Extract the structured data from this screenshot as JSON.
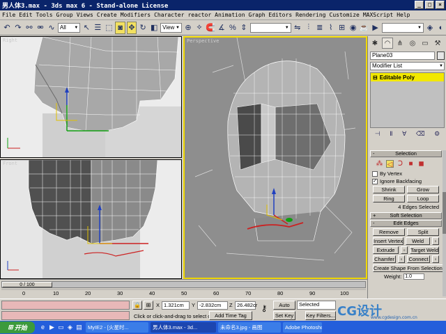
{
  "window": {
    "title": "男人体3.max - 3ds max 6 - Stand-alone License",
    "controls": [
      "_",
      "□",
      "×"
    ]
  },
  "menu": [
    "File",
    "Edit",
    "Tools",
    "Group",
    "Views",
    "Create",
    "Modifiers",
    "Character",
    "reactor",
    "Animation",
    "Graph Editors",
    "Rendering",
    "Customize",
    "MAXScript",
    "Help"
  ],
  "toolbar": {
    "selection_filter": "All",
    "ref_coord": "View",
    "named_sel": ""
  },
  "viewports": {
    "right": "Right",
    "front": "Front",
    "perspective": "Perspective"
  },
  "timeline": {
    "frame_display": "0 / 100",
    "ticks": [
      "0",
      "10",
      "20",
      "30",
      "40",
      "50",
      "60",
      "70",
      "80",
      "90",
      "100"
    ]
  },
  "status": {
    "prompt": "Click or click-and-drag to select obj",
    "add_time_tag": "Add Time Tag",
    "x_label": "X",
    "x_value": "1.321cm",
    "y_label": "Y",
    "y_value": "-2.832cm",
    "z_label": "Z",
    "z_value": "26.482cr",
    "auto_key": "Auto Key",
    "selected": "Selected",
    "set_key": "Set Key",
    "key_filters": "Key Filters..."
  },
  "panel": {
    "object_name": "Plane03",
    "object_color": "#e6e6e6",
    "modifier_list": "Modifier List",
    "stack_item": "Editable Poly",
    "selection": {
      "title": "Selection",
      "by_vertex": "By Vertex",
      "ignore_backfacing": "Ignore Backfacing",
      "shrink": "Shrink",
      "grow": "Grow",
      "ring": "Ring",
      "loop": "Loop",
      "info": "4 Edges Selected"
    },
    "soft_selection": "Soft Selection",
    "edit_edges": {
      "title": "Edit Edges",
      "remove": "Remove",
      "split": "Split",
      "insert_vertex": "Insert Vertex",
      "weld": "Weld",
      "extrude": "Extrude",
      "target_weld": "Target Weld",
      "chamfer": "Chamfer",
      "connect": "Connect",
      "create_shape": "Create Shape From Selection",
      "weight_label": "Weight:",
      "weight_value": "1.0"
    }
  },
  "taskbar": {
    "start": "开始",
    "tasks": [
      "MyIE2 - [火星时...",
      "男人体3.max - 3d...",
      "未命名3.jpg - 画图",
      "Adobe Photoshop"
    ]
  },
  "watermark": {
    "logo": "CG设计",
    "url": "www.cgdesign.com.cn"
  },
  "colors": {
    "title_bar": "#0a246a",
    "active_viewport_border": "#f0d800",
    "stack_highlight": "#f2e800",
    "taskbar": "#245edb"
  }
}
